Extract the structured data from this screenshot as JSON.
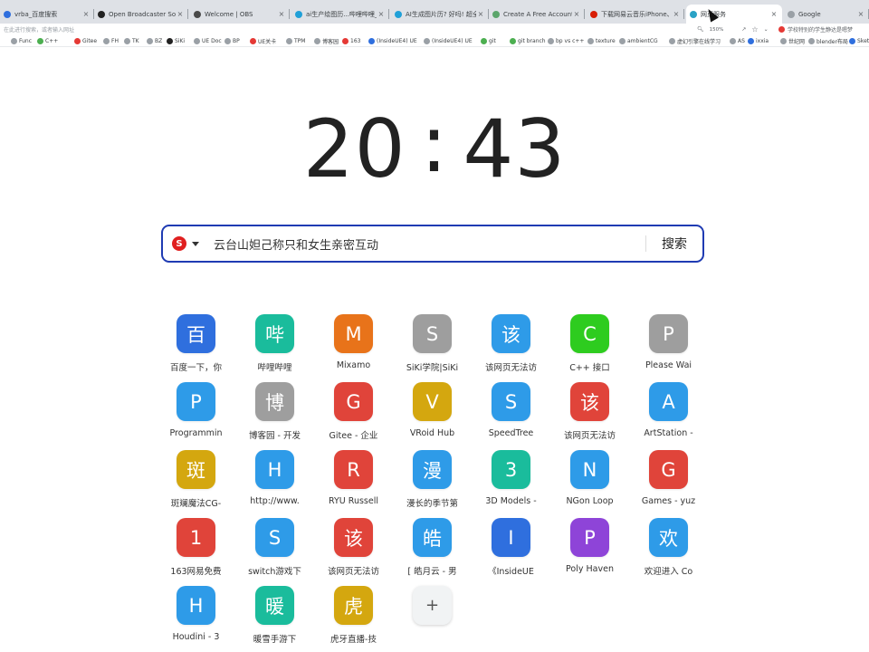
{
  "browser": {
    "tabs": [
      {
        "title": "vrba_百度搜索",
        "color": "#2f6fde",
        "active": false
      },
      {
        "title": "Open Broadcaster Software",
        "color": "#222222",
        "active": false
      },
      {
        "title": "Welcome | OBS",
        "color": "#4a4a4a",
        "active": false
      },
      {
        "title": "ai生产绘图历...哔哩哔哩_BILI...",
        "color": "#20a0d8",
        "active": false
      },
      {
        "title": "AI生成图片历? 好吗! 超全面",
        "color": "#20a0d8",
        "active": false
      },
      {
        "title": "Create A Free Account At Au...",
        "color": "#5ba56b",
        "active": false
      },
      {
        "title": "下载网易云音乐iPhone、iPad...",
        "color": "#d81e06",
        "active": false
      },
      {
        "title": "网页服务",
        "color": "#2aa2c5",
        "active": true
      },
      {
        "title": "Google",
        "color": "#9aa0a6",
        "active": false
      }
    ],
    "address_placeholder": "在此进行搜索，或者输入网址",
    "zoom": "150%",
    "side_note": "学校特别的学生静达是嗯梦",
    "bookmarks": [
      {
        "label": "Func",
        "color": "#9aa0a6"
      },
      {
        "label": "C++",
        "color": "#4caf50"
      },
      {
        "label": "Gitee",
        "color": "#e53935"
      },
      {
        "label": "FH",
        "color": "#9aa0a6"
      },
      {
        "label": "TK",
        "color": "#9aa0a6"
      },
      {
        "label": "BZ",
        "color": "#9aa0a6"
      },
      {
        "label": "SiKi",
        "color": "#222222"
      },
      {
        "label": "UE Doc",
        "color": "#9aa0a6"
      },
      {
        "label": "BP",
        "color": "#9aa0a6"
      },
      {
        "label": "UE关卡",
        "color": "#e53935"
      },
      {
        "label": "TPM",
        "color": "#9aa0a6"
      },
      {
        "label": "博客园",
        "color": "#9aa0a6"
      },
      {
        "label": "163",
        "color": "#e53935"
      },
      {
        "label": "(InsideUE4) UE",
        "color": "#2f6fde"
      },
      {
        "label": "(InsideUE4) UE",
        "color": "#9aa0a6"
      },
      {
        "label": "git",
        "color": "#4caf50"
      },
      {
        "label": "git branch",
        "color": "#4caf50"
      },
      {
        "label": "bp vs c++",
        "color": "#9aa0a6"
      },
      {
        "label": "texture",
        "color": "#9aa0a6"
      },
      {
        "label": "ambientCG",
        "color": "#9aa0a6"
      },
      {
        "label": "虚幻引擎在线学习",
        "color": "#9aa0a6"
      },
      {
        "label": "AS",
        "color": "#9aa0a6"
      },
      {
        "label": "ixxia",
        "color": "#2f6fde"
      },
      {
        "label": "世纪网",
        "color": "#9aa0a6"
      },
      {
        "label": "blender布局",
        "color": "#9aa0a6"
      },
      {
        "label": "Sket",
        "color": "#2f6fde"
      }
    ]
  },
  "clock": {
    "hours": "20",
    "minutes": "43",
    "separator": ":"
  },
  "search": {
    "value": "云台山妲己称只和女生亲密互动",
    "button_label": "搜索",
    "engine_glyph": "S"
  },
  "shortcuts": [
    {
      "glyph": "百",
      "label": "百度一下，你",
      "color": "#2f6fde"
    },
    {
      "glyph": "哔",
      "label": "哔哩哔哩",
      "color": "#1abc9c"
    },
    {
      "glyph": "M",
      "label": "Mixamo",
      "color": "#e8731a"
    },
    {
      "glyph": "S",
      "label": "SiKi学院|SiKi",
      "color": "#9e9e9e"
    },
    {
      "glyph": "该",
      "label": "该网页无法访",
      "color": "#2e9be8"
    },
    {
      "glyph": "C",
      "label": "C++ 接口",
      "color": "#2ecc1f"
    },
    {
      "glyph": "P",
      "label": "Please Wai",
      "color": "#9e9e9e"
    },
    {
      "glyph": "P",
      "label": "Programmin",
      "color": "#2e9be8"
    },
    {
      "glyph": "博",
      "label": "博客园 - 开发",
      "color": "#9e9e9e"
    },
    {
      "glyph": "G",
      "label": "Gitee - 企业",
      "color": "#e0443a"
    },
    {
      "glyph": "V",
      "label": "VRoid Hub",
      "color": "#d4a70f"
    },
    {
      "glyph": "S",
      "label": "SpeedTree",
      "color": "#2e9be8"
    },
    {
      "glyph": "该",
      "label": "该网页无法访",
      "color": "#e0443a"
    },
    {
      "glyph": "A",
      "label": "ArtStation -",
      "color": "#2e9be8"
    },
    {
      "glyph": "斑",
      "label": "斑斓魔法CG-",
      "color": "#d4a70f"
    },
    {
      "glyph": "H",
      "label": "http://www.",
      "color": "#2e9be8"
    },
    {
      "glyph": "R",
      "label": "RYU Russell",
      "color": "#e0443a"
    },
    {
      "glyph": "漫",
      "label": "漫长的季节第",
      "color": "#2e9be8"
    },
    {
      "glyph": "3",
      "label": "3D Models -",
      "color": "#1abc9c"
    },
    {
      "glyph": "N",
      "label": "NGon Loop",
      "color": "#2e9be8"
    },
    {
      "glyph": "G",
      "label": "Games - yuz",
      "color": "#e0443a"
    },
    {
      "glyph": "1",
      "label": "163网易免费",
      "color": "#e0443a"
    },
    {
      "glyph": "S",
      "label": "switch游戏下",
      "color": "#2e9be8"
    },
    {
      "glyph": "该",
      "label": "该网页无法访",
      "color": "#e0443a"
    },
    {
      "glyph": "皓",
      "label": "[ 皓月云 - 男",
      "color": "#2e9be8"
    },
    {
      "glyph": "I",
      "label": "《InsideUE",
      "color": "#2f6fde"
    },
    {
      "glyph": "P",
      "label": "Poly Haven",
      "color": "#8e44d8"
    },
    {
      "glyph": "欢",
      "label": "欢迎进入 Co",
      "color": "#2e9be8"
    },
    {
      "glyph": "H",
      "label": "Houdini - 3",
      "color": "#2e9be8"
    },
    {
      "glyph": "暖",
      "label": "暖雪手游下",
      "color": "#1abc9c"
    },
    {
      "glyph": "虎",
      "label": "虎牙直播-技",
      "color": "#d4a70f"
    }
  ],
  "add_shortcut_glyph": "+"
}
